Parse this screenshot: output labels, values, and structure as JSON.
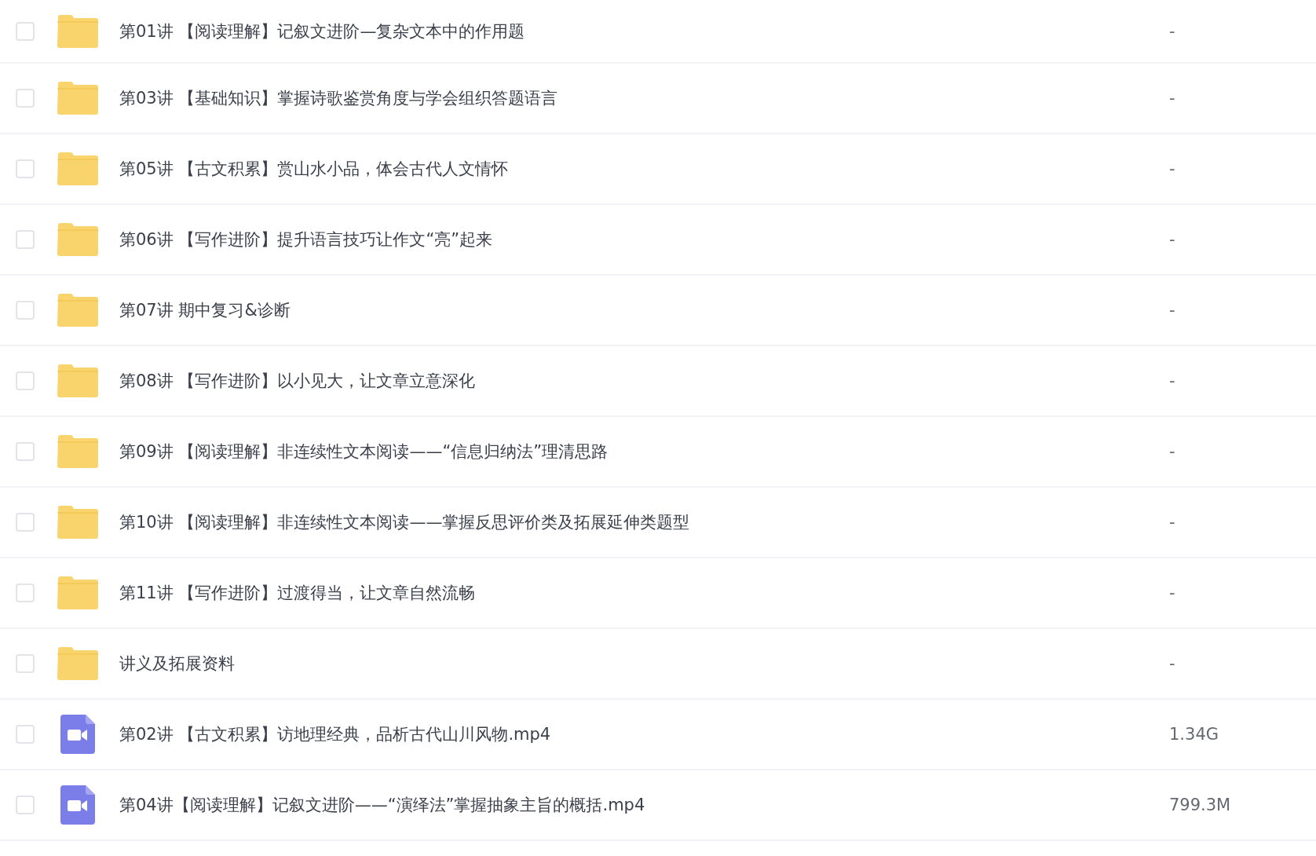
{
  "files": [
    {
      "kind": "folder",
      "checked": false,
      "name": "第01讲 【阅读理解】记叙文进阶—复杂文本中的作用题",
      "size": "-"
    },
    {
      "kind": "folder",
      "checked": false,
      "name": "第03讲 【基础知识】掌握诗歌鉴赏角度与学会组织答题语言",
      "size": "-"
    },
    {
      "kind": "folder",
      "checked": false,
      "name": "第05讲 【古文积累】赏山水小品，体会古代人文情怀",
      "size": "-"
    },
    {
      "kind": "folder",
      "checked": false,
      "name": "第06讲 【写作进阶】提升语言技巧让作文“亮”起来",
      "size": "-"
    },
    {
      "kind": "folder",
      "checked": false,
      "name": "第07讲 期中复习&诊断",
      "size": "-"
    },
    {
      "kind": "folder",
      "checked": false,
      "name": "第08讲 【写作进阶】以小见大，让文章立意深化",
      "size": "-"
    },
    {
      "kind": "folder",
      "checked": false,
      "name": "第09讲 【阅读理解】非连续性文本阅读——“信息归纳法”理清思路",
      "size": "-"
    },
    {
      "kind": "folder",
      "checked": false,
      "name": "第10讲 【阅读理解】非连续性文本阅读——掌握反思评价类及拓展延伸类题型",
      "size": "-"
    },
    {
      "kind": "folder",
      "checked": false,
      "name": "第11讲 【写作进阶】过渡得当，让文章自然流畅",
      "size": "-"
    },
    {
      "kind": "folder",
      "checked": false,
      "name": "讲义及拓展资料",
      "size": "-"
    },
    {
      "kind": "video",
      "checked": false,
      "name": "第02讲 【古文积累】访地理经典，品析古代山川风物.mp4",
      "size": "1.34G"
    },
    {
      "kind": "video",
      "checked": false,
      "name": "第04讲【阅读理解】记叙文进阶——“演绎法”掌握抽象主旨的概括.mp4",
      "size": "799.3M"
    }
  ]
}
